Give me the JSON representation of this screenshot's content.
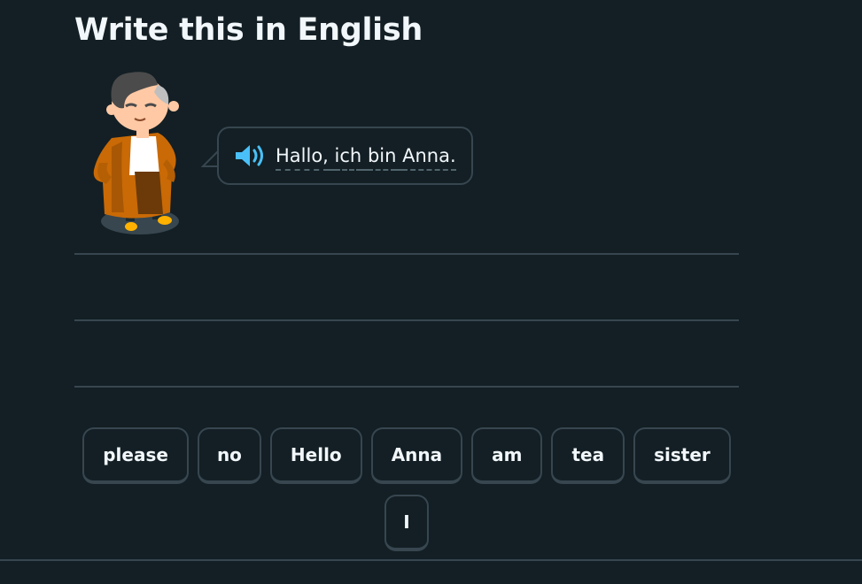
{
  "header": {
    "title": "Write this in English"
  },
  "prompt": {
    "character_icon": "anna-character-icon",
    "speaker_icon": "speaker-icon",
    "words": [
      "Hallo,",
      " ",
      "ich",
      " ",
      "bin",
      " ",
      "Anna."
    ]
  },
  "word_bank": {
    "chips": [
      "please",
      "no",
      "Hello",
      "Anna",
      "am",
      "tea",
      "sister",
      "I"
    ]
  },
  "colors": {
    "background": "#131f24",
    "border": "#37464f",
    "text": "#f1f7fb",
    "speaker": "#49c0f8",
    "character_coat": "#c96a06"
  }
}
